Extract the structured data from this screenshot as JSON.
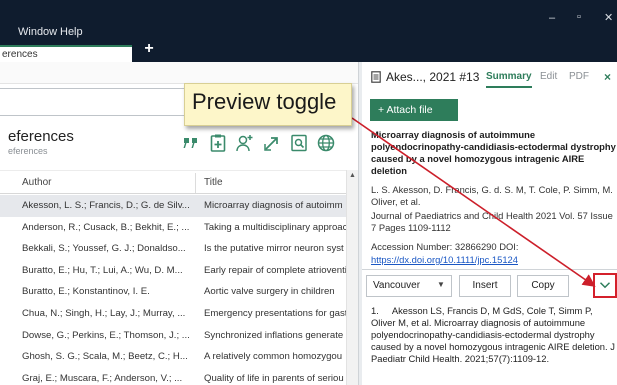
{
  "menu": {
    "window": "Window",
    "help": "Help"
  },
  "window_controls": {
    "minimize": "–",
    "restore": "▫",
    "close": "✕"
  },
  "tabs": {
    "active_label": "erences",
    "add_label": "+"
  },
  "left": {
    "group_title": "eferences",
    "group_subtitle": "eferences",
    "toolbar_icons": [
      "quote-icon",
      "add-reference-icon",
      "share-user-icon",
      "export-icon",
      "find-fulltext-icon",
      "online-search-icon"
    ],
    "columns": {
      "author": "Author",
      "title": "Title"
    },
    "rows": [
      {
        "author": "Akesson, L. S.; Francis, D.; G. de Silv...",
        "title": "Microarray diagnosis of autoimm"
      },
      {
        "author": "Anderson, R.; Cusack, B.; Bekhit, E.; ...",
        "title": "Taking a multidisciplinary approac"
      },
      {
        "author": "Bekkali, S.; Youssef, G. J.; Donaldso...",
        "title": "Is the putative mirror neuron syst"
      },
      {
        "author": "Buratto, E.; Hu, T.; Lui, A.; Wu, D. M...",
        "title": "Early repair of complete atrioventi"
      },
      {
        "author": "Buratto, E.; Konstantinov, I. E.",
        "title": "Aortic valve surgery in children"
      },
      {
        "author": "Chua, N.; Singh, H.; Lay, J.; Murray, ...",
        "title": "Emergency presentations for gast"
      },
      {
        "author": "Dowse, G.; Perkins, E.; Thomson, J.; ...",
        "title": "Synchronized inflations generate"
      },
      {
        "author": "Ghosh, S. G.; Scala, M.; Beetz, C.; H...",
        "title": "A relatively common homozygou"
      },
      {
        "author": "Graj, E.; Muscara, F.; Anderson, V.; ...",
        "title": "Quality of life in parents of seriou"
      }
    ],
    "selected_index": 0
  },
  "right": {
    "heading": "Akes..., 2021 #13",
    "tabs": {
      "summary": "Summary",
      "edit": "Edit",
      "pdf": "PDF"
    },
    "close_label": "×",
    "attach_label": "+  Attach file",
    "title": "Microarray diagnosis of autoimmune polyendocrinopathy-candidiasis-ectodermal dystrophy caused by a novel homozygous intragenic AIRE deletion",
    "authors": "L. S. Akesson, D. Francis, G. d. S. M, T. Cole, P. Simm, M. Oliver, et al.",
    "journal": "Journal of Paediatrics and Child Health 2021 Vol. 57 Issue 7 Pages 1109-1112",
    "accession": "Accession Number: 32866290 DOI:",
    "doi": "https://dx.doi.org/10.1111/jpc.15124",
    "style_select": "Vancouver",
    "insert_label": "Insert",
    "copy_label": "Copy",
    "toggle_glyph": "⌄",
    "citation": "1.     Akesson LS, Francis D, M GdS, Cole T, Simm P, Oliver M, et al. Microarray diagnosis of autoimmune polyendocrinopathy-candidiasis-ectodermal dystrophy caused by a novel homozygous intragenic AIRE deletion. J Paediatr Child Health. 2021;57(7):1109-12."
  },
  "callout": {
    "text": "Preview toggle",
    "arrow_color": "#cc1f2a",
    "fill_color": "#fdf6c9"
  },
  "colors": {
    "accent": "#2e7d5b",
    "titlebar": "#0f1c2e",
    "link": "#1a57c4",
    "highlight_border": "#d4202b"
  }
}
